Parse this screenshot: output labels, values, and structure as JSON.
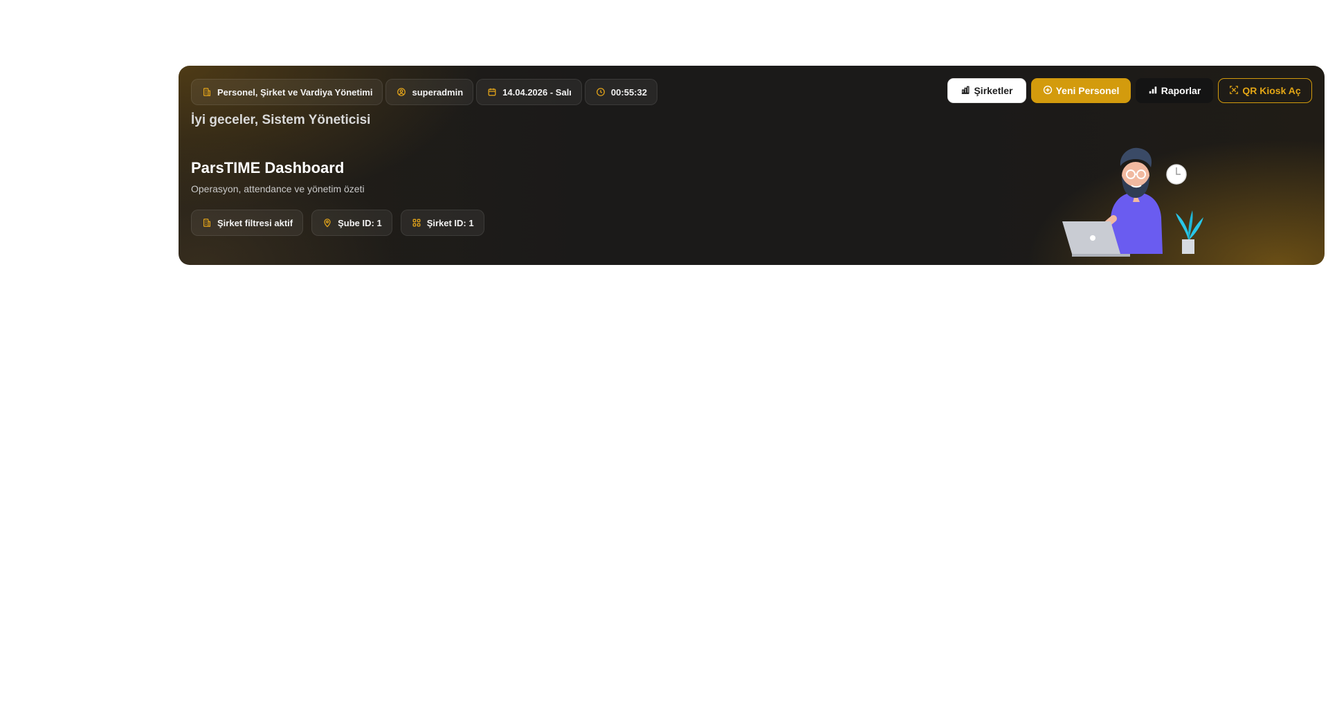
{
  "top_chips": [
    {
      "label": "Personel, Şirket ve Vardiya Yönetimi",
      "icon": "building-icon"
    },
    {
      "label": "superadmin",
      "icon": "user-circle-icon"
    },
    {
      "label": "14.04.2026 - Salı",
      "icon": "calendar-icon"
    },
    {
      "label": "00:55:32",
      "icon": "clock-icon"
    }
  ],
  "greeting": "İyi geceler, Sistem Yöneticisi",
  "title": "ParsTIME Dashboard",
  "subtitle": "Operasyon, attendance ve yönetim özeti",
  "filter_chips": [
    {
      "label": "Şirket filtresi aktif",
      "icon": "building-icon"
    },
    {
      "label": "Şube ID: 1",
      "icon": "map-pin-icon"
    },
    {
      "label": "Şirket ID: 1",
      "icon": "grid-icon"
    }
  ],
  "actions": {
    "companies": "Şirketler",
    "new_staff": "Yeni Personel",
    "reports": "Raporlar",
    "qr_kiosk": "QR Kiosk Aç"
  },
  "colors": {
    "accent": "#d39b0d",
    "hero_bg": "#1b1a19",
    "accent_icon": "#e0a21a"
  }
}
